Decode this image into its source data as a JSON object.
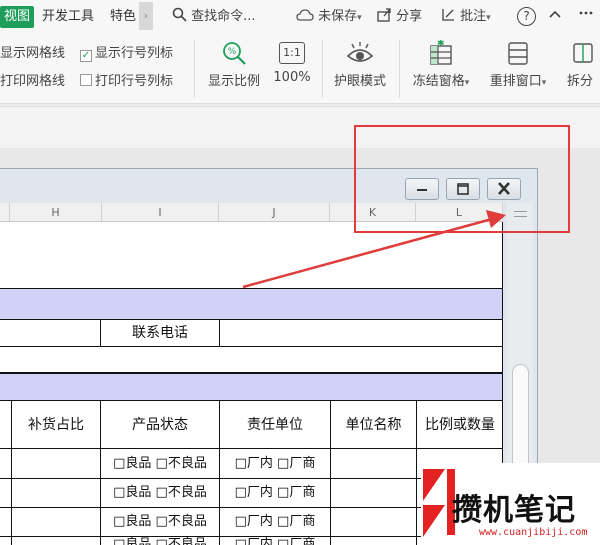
{
  "tabs": {
    "view": "视图",
    "developer": "开发工具",
    "special": "特色",
    "more": "›"
  },
  "toolbar": {
    "search": "查找命令...",
    "unsaved": "未保存",
    "share": "分享",
    "comment": "批注",
    "help": "?"
  },
  "ribbon": {
    "show_gridlines": "显示网格线",
    "show_headers": "显示行号列标",
    "print_gridlines": "打印网格线",
    "print_headers": "打印行号列标",
    "zoom": "显示比例",
    "zoom_100_icon": "1:1",
    "zoom_100": "100%",
    "eye_mode": "护眼模式",
    "freeze": "冻结窗格",
    "arrange": "重排窗口",
    "split": "拆分"
  },
  "window_controls": [
    "minimize",
    "restore",
    "close"
  ],
  "columns": [
    "H",
    "I",
    "J",
    "K",
    "L"
  ],
  "sheet": {
    "contact_phone": "联系电话",
    "headers": [
      "补货占比",
      "产品状态",
      "责任单位",
      "单位名称",
      "比例或数量"
    ],
    "status_options": "□良品 □不良品",
    "unit_options": "□厂内 □厂商"
  },
  "watermark": {
    "name": "攒机笔记",
    "url": "www.cuanjibiji.com"
  },
  "colors": {
    "accent": "#1e9e5a",
    "highlight": "#e03c3c",
    "band": "#d0d2f8"
  }
}
